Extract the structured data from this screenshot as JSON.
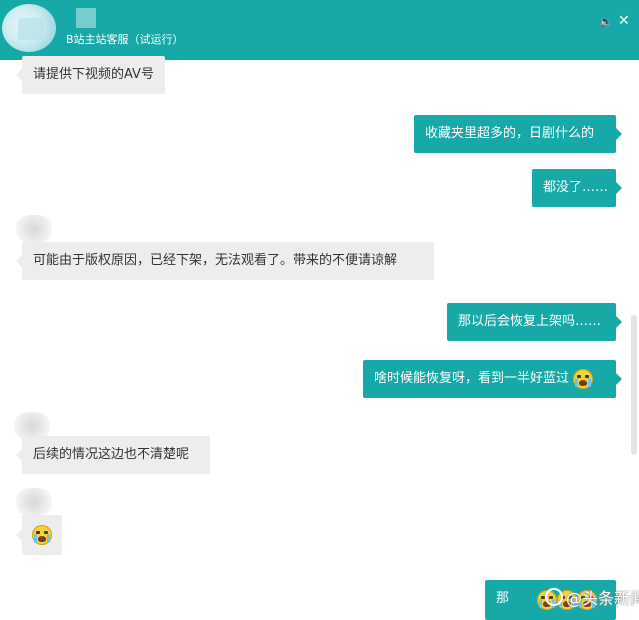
{
  "header": {
    "title": "B站主站客服（试运行）",
    "sound_icon": "speaker-icon",
    "close_icon": "close-icon",
    "accent": "#16a9a8"
  },
  "messages": [
    {
      "side": "in",
      "text": "请提供下视频的AV号"
    },
    {
      "side": "out",
      "text": "收藏夹里超多的，日剧什么的"
    },
    {
      "side": "out",
      "text": "都没了……"
    },
    {
      "side": "in",
      "text": "可能由于版权原因，已经下架，无法观看了。带来的不便请谅解"
    },
    {
      "side": "out",
      "text": "那以后会恢复上架吗……"
    },
    {
      "side": "out",
      "text": "啥时候能恢复呀，看到一半好蓝过",
      "emoji": "crying-face-icon"
    },
    {
      "side": "in",
      "text": "后续的情况这边也不清楚呢"
    },
    {
      "side": "in",
      "emoji": "crying-face-icon"
    },
    {
      "side": "out",
      "text": "那"
    }
  ],
  "watermark": {
    "text": "@头条新闻",
    "logo": "toutiao-logo-icon"
  },
  "colors": {
    "incoming_bubble": "#ededed",
    "outgoing_bubble": "#16a9a8"
  }
}
